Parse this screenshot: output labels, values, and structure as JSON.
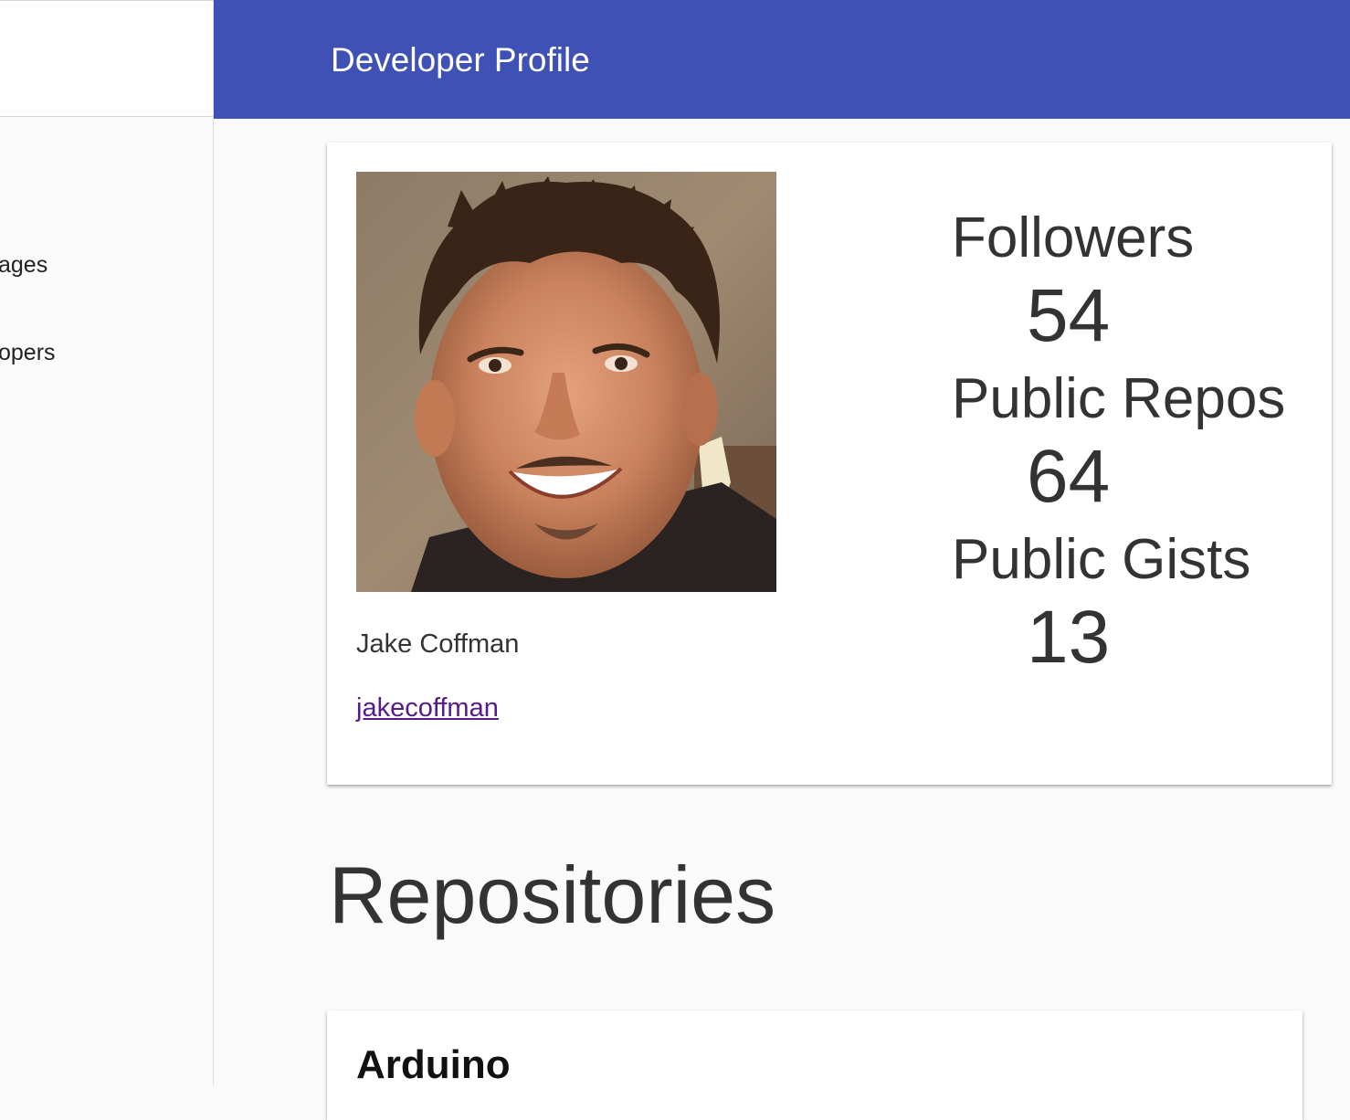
{
  "sidebar": {
    "items": [
      {
        "label": "ages"
      },
      {
        "label": "opers"
      }
    ]
  },
  "appbar": {
    "title": "Developer Profile"
  },
  "profile": {
    "name": "Jake Coffman",
    "login": "jakecoffman",
    "stats": [
      {
        "label": "Followers",
        "value": "54"
      },
      {
        "label": "Public Repos",
        "value": "64"
      },
      {
        "label": "Public Gists",
        "value": "13"
      }
    ]
  },
  "repositories": {
    "title": "Repositories",
    "items": [
      {
        "name": "Arduino"
      }
    ]
  },
  "colors": {
    "appbar": "#3f51b5",
    "link": "#551a8b",
    "background": "#fafafa"
  }
}
